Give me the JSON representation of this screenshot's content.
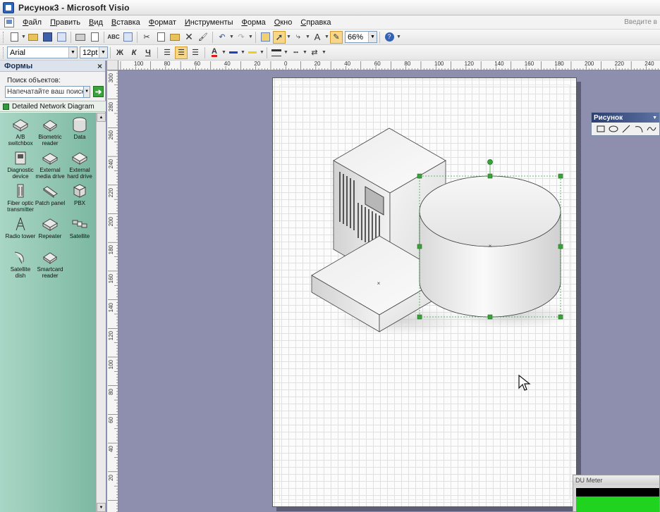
{
  "window": {
    "title": "Рисунок3 - Microsoft Visio"
  },
  "menu": {
    "items": [
      {
        "u": "Ф",
        "rest": "айл"
      },
      {
        "u": "П",
        "rest": "равить"
      },
      {
        "u": "В",
        "rest": "ид"
      },
      {
        "u": "В",
        "rest": "ставка"
      },
      {
        "u": "Ф",
        "rest": "ормат"
      },
      {
        "u": "И",
        "rest": "нструменты"
      },
      {
        "u": "Ф",
        "rest": "орма"
      },
      {
        "u": "О",
        "rest": "кно"
      },
      {
        "u": "С",
        "rest": "правка"
      }
    ],
    "help_placeholder": "Введите в"
  },
  "toolbar": {
    "zoom": "66%",
    "font_name": "Arial",
    "font_size": "12pt",
    "bold": "Ж",
    "italic": "К",
    "underline": "Ч",
    "text_tool": "A"
  },
  "shapes_panel": {
    "title": "Формы",
    "search_label": "Поиск объектов:",
    "search_placeholder": "Напечатайте ваш поиск",
    "stencil_name": "Detailed Network Diagram",
    "shapes": [
      {
        "label1": "A/B",
        "label2": "switchbox",
        "icon": "ab-switchbox-icon"
      },
      {
        "label1": "Biometric",
        "label2": "reader",
        "icon": "biometric-reader-icon"
      },
      {
        "label1": "Data",
        "label2": "",
        "icon": "data-icon"
      },
      {
        "label1": "Diagnostic",
        "label2": "device",
        "icon": "diagnostic-device-icon"
      },
      {
        "label1": "External",
        "label2": "media drive",
        "icon": "external-media-drive-icon"
      },
      {
        "label1": "External",
        "label2": "hard drive",
        "icon": "external-hard-drive-icon"
      },
      {
        "label1": "Fiber optic",
        "label2": "transmitter",
        "icon": "fiber-optic-transmitter-icon"
      },
      {
        "label1": "Patch panel",
        "label2": "",
        "icon": "patch-panel-icon"
      },
      {
        "label1": "PBX",
        "label2": "",
        "icon": "pbx-icon"
      },
      {
        "label1": "Radio tower",
        "label2": "",
        "icon": "radio-tower-icon"
      },
      {
        "label1": "Repeater",
        "label2": "",
        "icon": "repeater-icon"
      },
      {
        "label1": "Satellite",
        "label2": "",
        "icon": "satellite-icon"
      },
      {
        "label1": "Satellite",
        "label2": "dish",
        "icon": "satellite-dish-icon"
      },
      {
        "label1": "Smartcard",
        "label2": "reader",
        "icon": "smartcard-reader-icon"
      }
    ]
  },
  "rulers": {
    "top_labels": [
      "100",
      "80",
      "60",
      "40",
      "20",
      "0",
      "20",
      "40",
      "60",
      "80",
      "100",
      "120",
      "140",
      "160",
      "180",
      "200",
      "220",
      "240"
    ],
    "left_labels": [
      "300",
      "280",
      "260",
      "240",
      "220",
      "200",
      "180",
      "160",
      "140",
      "120",
      "100",
      "80",
      "60",
      "40",
      "20"
    ]
  },
  "drawing_toolbar": {
    "title": "Рисунок"
  },
  "du_meter": {
    "title": "DU Meter"
  },
  "colors": {
    "selection": "#3aa23a",
    "stencil": "#8ec4b0",
    "workspace": "#8e8fae"
  }
}
